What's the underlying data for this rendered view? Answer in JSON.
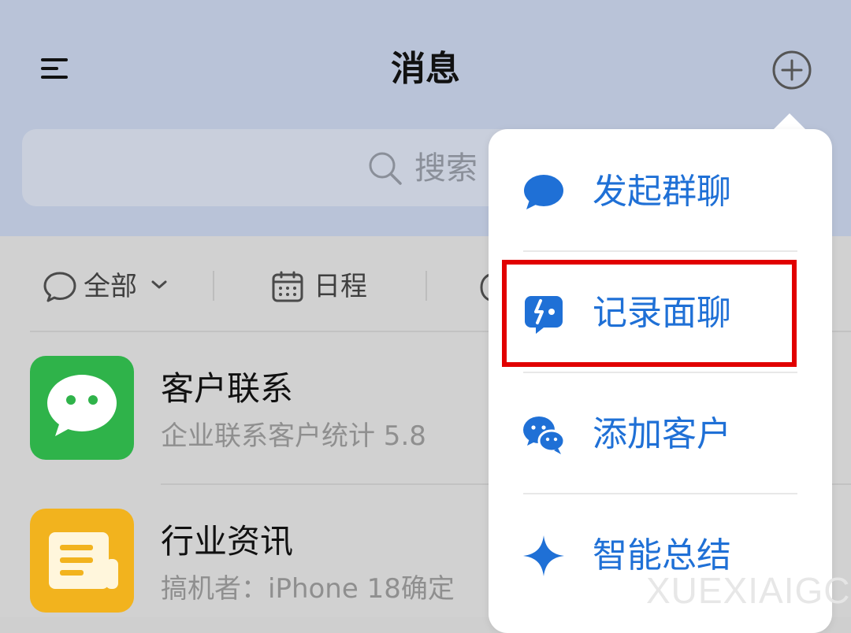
{
  "header": {
    "title": "消息"
  },
  "search": {
    "placeholder": "搜索"
  },
  "filters": [
    {
      "label": "全部"
    },
    {
      "label": "日程"
    }
  ],
  "list": [
    {
      "title": "客户联系",
      "subtitle": "企业联系客户统计 5.8"
    },
    {
      "title": "行业资讯",
      "subtitle": "搞机者：iPhone 18确定"
    }
  ],
  "dropdown": {
    "items": [
      {
        "label": "发起群聊",
        "icon": "chat-bubble-icon"
      },
      {
        "label": "记录面聊",
        "icon": "face-chat-record-icon"
      },
      {
        "label": "添加客户",
        "icon": "wechat-icon"
      },
      {
        "label": "智能总结",
        "icon": "sparkle-icon"
      }
    ]
  },
  "watermark": "XUEXIAIGC",
  "colors": {
    "accent": "#1f70d6",
    "highlight": "#e10000",
    "header_bg": "#b9c3d8",
    "wechat_green": "#2fb34a",
    "news_yellow": "#f2b31e"
  }
}
